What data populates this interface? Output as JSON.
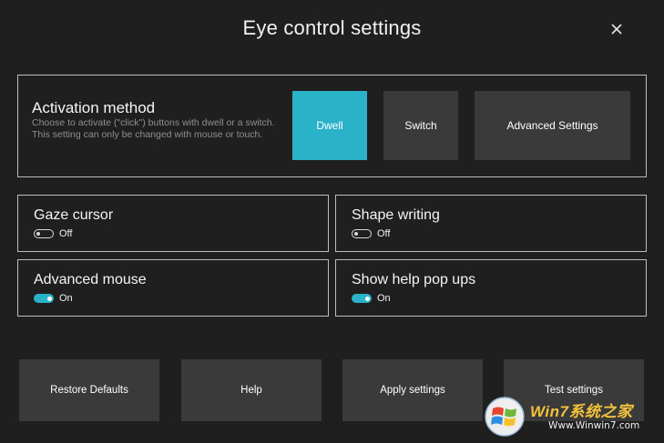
{
  "window": {
    "title": "Eye control settings"
  },
  "activation": {
    "title": "Activation method",
    "description": "Choose to activate (\"click\") buttons with dwell or a switch. This setting can only be changed with mouse or touch.",
    "buttons": {
      "dwell": "Dwell",
      "switch": "Switch",
      "advanced": "Advanced Settings"
    },
    "selected": "Dwell",
    "accent": "#2ab2c9"
  },
  "cards": [
    {
      "title": "Gaze cursor",
      "state": "Off"
    },
    {
      "title": "Shape writing",
      "state": "Off"
    },
    {
      "title": "Advanced mouse",
      "state": "On"
    },
    {
      "title": "Show help pop ups",
      "state": "On"
    }
  ],
  "footer": {
    "restore": "Restore Defaults",
    "help": "Help",
    "apply": "Apply settings",
    "test": "Test settings"
  },
  "watermark": {
    "brand": "Win7系统之家",
    "url": "Www.Winwin7.com"
  },
  "icons": {
    "close": "close-icon",
    "logo": "windows-logo-icon"
  }
}
